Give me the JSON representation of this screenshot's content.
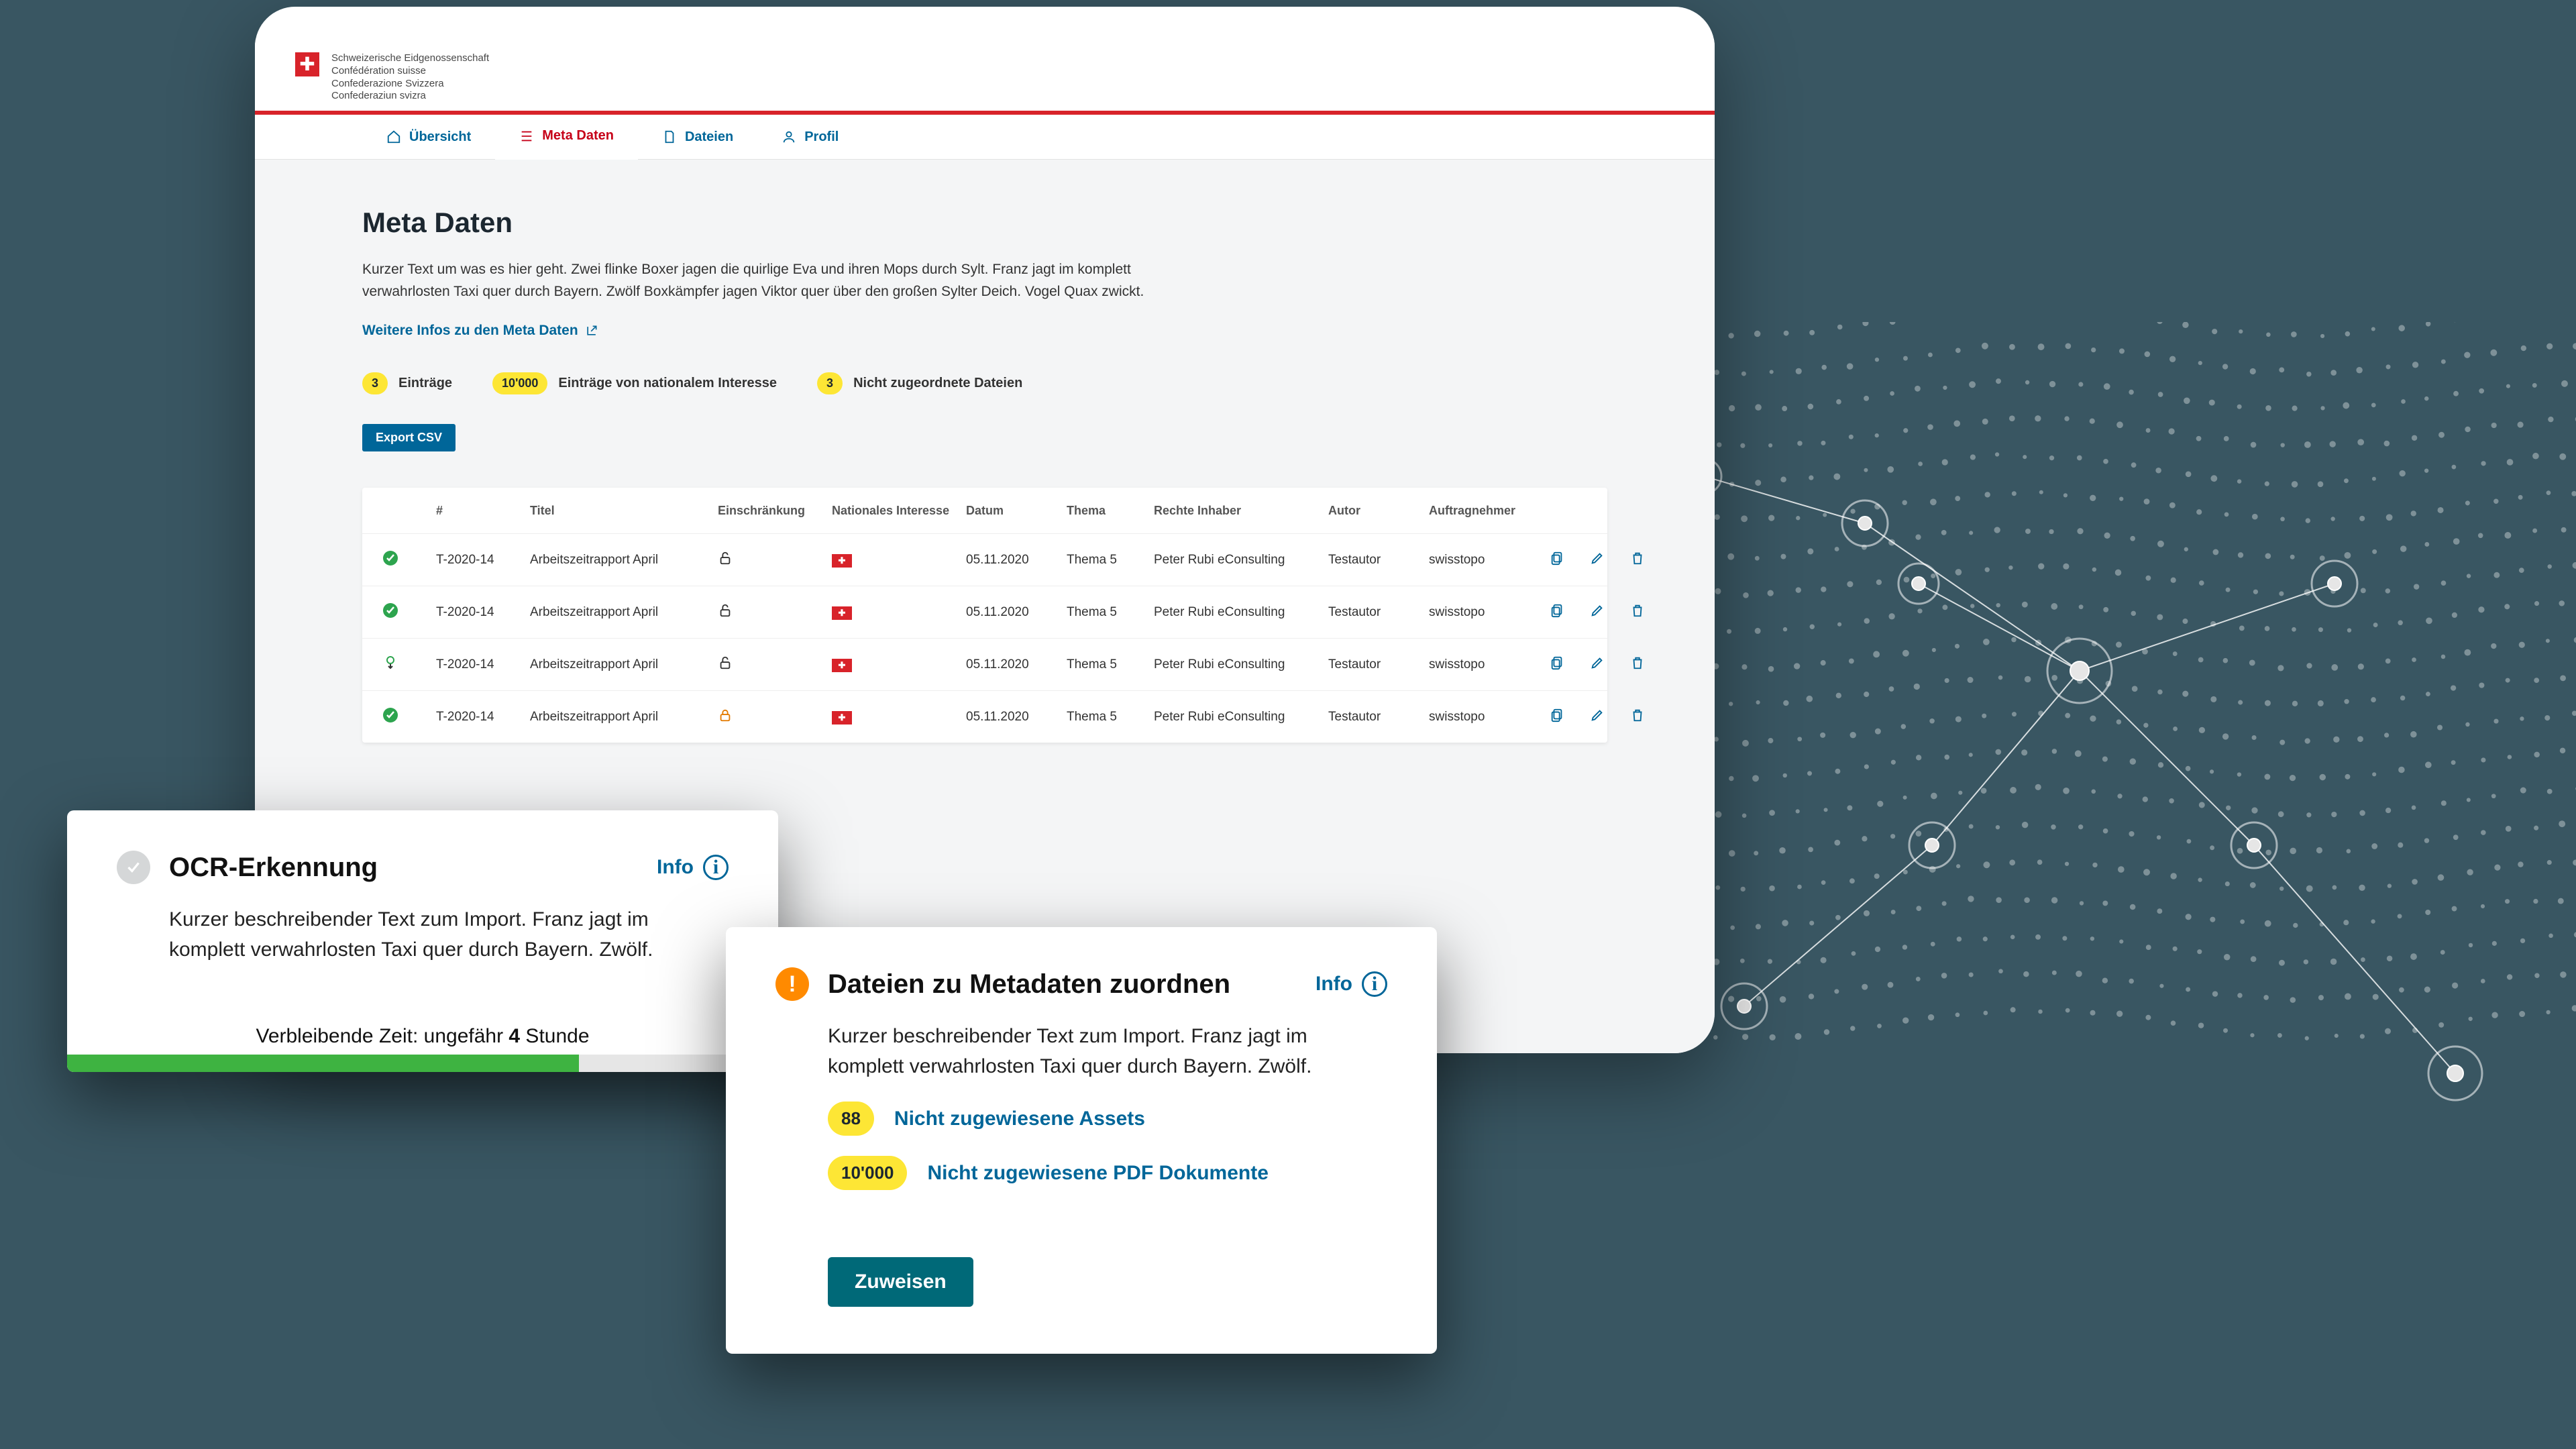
{
  "confederation_lines": "Schweizerische Eidgenossenschaft\nConfédération suisse\nConfederazione Svizzera\nConfederaziun svizra",
  "nav": {
    "overview": "Übersicht",
    "meta": "Meta Daten",
    "files": "Dateien",
    "profile": "Profil"
  },
  "page": {
    "title": "Meta Daten",
    "desc": "Kurzer Text um was es hier geht. Zwei flinke Boxer jagen die quirlige Eva und ihren Mops durch Sylt. Franz jagt im komplett verwahrlosten Taxi quer durch Bayern. Zwölf Boxkämpfer jagen Viktor quer über den großen Sylter Deich. Vogel Quax zwickt.",
    "more_link": "Weitere Infos zu den Meta Daten"
  },
  "stats": {
    "entries_count": "3",
    "entries_label": "Einträge",
    "national_count": "10'000",
    "national_label": "Einträge von nationalem Interesse",
    "unassigned_count": "3",
    "unassigned_label": "Nicht zugeordnete Dateien"
  },
  "export_label": "Export CSV",
  "table": {
    "headers": {
      "num": "#",
      "title": "Titel",
      "restriction": "Einschränkung",
      "national": "Nationales Interesse",
      "date": "Datum",
      "topic": "Thema",
      "rights": "Rechte Inhaber",
      "author": "Autor",
      "contractor": "Auftragnehmer"
    },
    "rows": [
      {
        "status": "ok",
        "id": "T-2020-14",
        "title": "Arbeitszeitrapport April",
        "lock": "open",
        "date": "05.11.2020",
        "topic": "Thema 5",
        "rights": "Peter Rubi eConsulting",
        "author": "Testautor",
        "contractor": "swisstopo"
      },
      {
        "status": "ok",
        "id": "T-2020-14",
        "title": "Arbeitszeitrapport April",
        "lock": "open",
        "date": "05.11.2020",
        "topic": "Thema 5",
        "rights": "Peter Rubi eConsulting",
        "author": "Testautor",
        "contractor": "swisstopo"
      },
      {
        "status": "import",
        "id": "T-2020-14",
        "title": "Arbeitszeitrapport April",
        "lock": "open",
        "date": "05.11.2020",
        "topic": "Thema 5",
        "rights": "Peter Rubi eConsulting",
        "author": "Testautor",
        "contractor": "swisstopo"
      },
      {
        "status": "ok",
        "id": "T-2020-14",
        "title": "Arbeitszeitrapport April",
        "lock": "closed",
        "date": "05.11.2020",
        "topic": "Thema 5",
        "rights": "Peter Rubi eConsulting",
        "author": "Testautor",
        "contractor": "swisstopo"
      }
    ]
  },
  "ocr": {
    "title": "OCR-Erkennung",
    "info_label": "Info",
    "desc": "Kurzer beschreibender Text zum Import. Franz jagt im komplett verwahrlosten Taxi quer durch Bayern. Zwölf.",
    "remaining_prefix": "Verbleibende Zeit: ungefähr ",
    "remaining_bold": "4",
    "remaining_suffix": " Stunde"
  },
  "map": {
    "title": "Dateien zu Metadaten zuordnen",
    "info_label": "Info",
    "desc": "Kurzer beschreibender Text zum Import. Franz jagt im komplett verwahrlosten Taxi quer durch Bayern. Zwölf.",
    "assets_count": "88",
    "assets_label": "Nicht zugewiesene Assets",
    "pdf_count": "10'000",
    "pdf_label": "Nicht zugewiesene PDF Dokumente",
    "assign_label": "Zuweisen"
  }
}
